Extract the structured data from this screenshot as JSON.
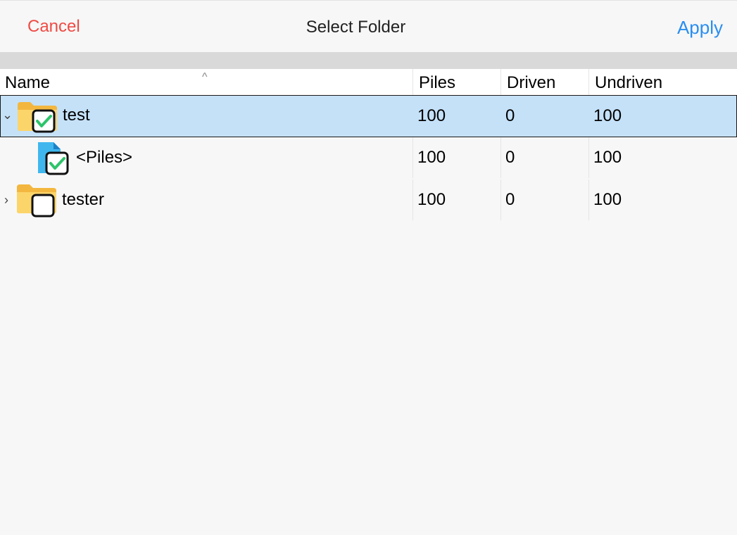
{
  "header_bar": {
    "cancel_label": "Cancel",
    "title": "Select Folder",
    "apply_label": "Apply"
  },
  "columns": [
    "Name",
    "Piles",
    "Driven",
    "Undriven"
  ],
  "rows": [
    {
      "name": "test",
      "piles": "100",
      "driven": "0",
      "undriven": "100",
      "checked": true,
      "expanded": true,
      "icon": "folder-icon"
    },
    {
      "name": "<Piles>",
      "piles": "100",
      "driven": "0",
      "undriven": "100",
      "checked": true,
      "icon": "file-icon"
    },
    {
      "name": "tester",
      "piles": "100",
      "driven": "0",
      "undriven": "100",
      "checked": false,
      "expanded": false,
      "icon": "folder-icon"
    }
  ],
  "colors": {
    "cancel": "#ef4b45",
    "apply": "#2a8ef0",
    "selection": "#c5e1f8",
    "check": "#2ec46a"
  }
}
